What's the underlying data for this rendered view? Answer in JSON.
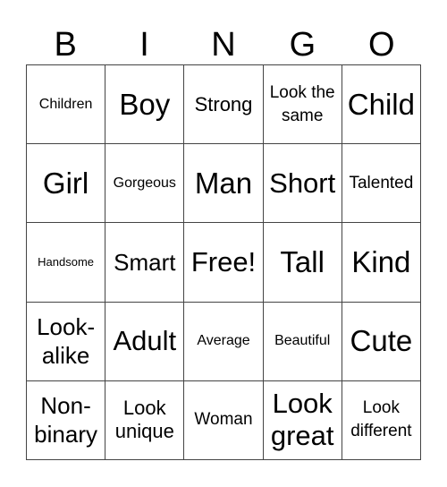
{
  "header": [
    "B",
    "I",
    "N",
    "G",
    "O"
  ],
  "cells": [
    {
      "text": "Children",
      "size": "s15"
    },
    {
      "text": "Boy",
      "size": "s32"
    },
    {
      "text": "Strong",
      "size": "s22"
    },
    {
      "text": "Look the same",
      "size": "s19"
    },
    {
      "text": "Child",
      "size": "s32"
    },
    {
      "text": "Girl",
      "size": "s32"
    },
    {
      "text": "Gorgeous",
      "size": "s15"
    },
    {
      "text": "Man",
      "size": "s32"
    },
    {
      "text": "Short",
      "size": "s30"
    },
    {
      "text": "Talented",
      "size": "s19"
    },
    {
      "text": "Handsome",
      "size": "s12"
    },
    {
      "text": "Smart",
      "size": "s24"
    },
    {
      "text": "Free!",
      "size": "s30"
    },
    {
      "text": "Tall",
      "size": "s32"
    },
    {
      "text": "Kind",
      "size": "s32"
    },
    {
      "text": "Look-alike",
      "size": "s24"
    },
    {
      "text": "Adult",
      "size": "s30"
    },
    {
      "text": "Average",
      "size": "s15"
    },
    {
      "text": "Beautiful",
      "size": "s15"
    },
    {
      "text": "Cute",
      "size": "s32"
    },
    {
      "text": "Non-binary",
      "size": "s24"
    },
    {
      "text": "Look unique",
      "size": "s22"
    },
    {
      "text": "Woman",
      "size": "s19"
    },
    {
      "text": "Look great",
      "size": "s30"
    },
    {
      "text": "Look different",
      "size": "s19"
    }
  ]
}
